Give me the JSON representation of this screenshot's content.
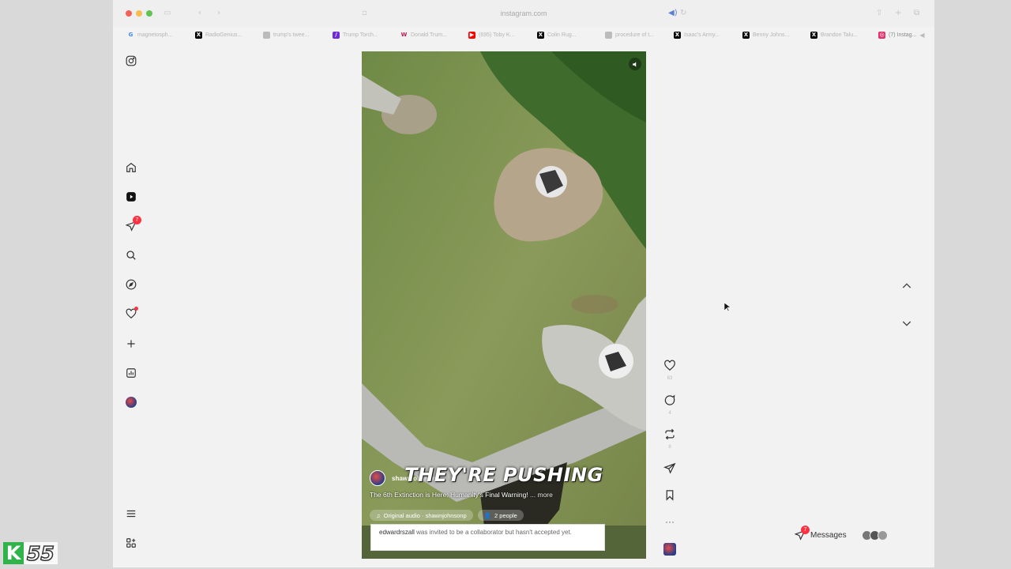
{
  "browser": {
    "url": "instagram.com",
    "tabs": [
      {
        "label": "magnetosph...",
        "icon": "google-icon",
        "color": "#4285f4"
      },
      {
        "label": "RadioGenius...",
        "icon": "x-icon",
        "color": "#000000"
      },
      {
        "label": "trump's twee...",
        "icon": "page-icon",
        "color": "#9a9a9a"
      },
      {
        "label": "Trump Torch...",
        "icon": "substack-icon",
        "color": "#6e2bd9"
      },
      {
        "label": "Donald Trum...",
        "icon": "wikipedia-icon",
        "color": "#c2185b"
      },
      {
        "label": "(695) Toby K...",
        "icon": "youtube-icon",
        "color": "#ff0000"
      },
      {
        "label": "Colin Rug...",
        "icon": "x-icon",
        "color": "#000000"
      },
      {
        "label": "procedure of t...",
        "icon": "page-icon",
        "color": "#9a9a9a"
      },
      {
        "label": "Isaac's Army...",
        "icon": "x-icon",
        "color": "#000000"
      },
      {
        "label": "Benny Johns...",
        "icon": "x-icon",
        "color": "#000000"
      },
      {
        "label": "Brandon Talu...",
        "icon": "x-icon",
        "color": "#000000"
      },
      {
        "label": "(7) Instag...",
        "icon": "instagram-icon",
        "color": "#e1306c"
      }
    ]
  },
  "nav": {
    "notifications_badge": "7"
  },
  "reel": {
    "overlay_text": "THEY'RE PUSHING",
    "author": "shawnjohnsonp",
    "caption": "The 6th Extinction is Here: Humanity's Final Warning!",
    "more_label": "... more",
    "audio_label": "Original audio · shawnjohnsonp",
    "people_label": "2 people",
    "collab_user": "edwardrszall",
    "collab_text": "was invited to be a collaborator but hasn't accepted yet."
  },
  "actions": {
    "likes": "63",
    "comments": "4",
    "reposts": "8"
  },
  "messages": {
    "label": "Messages",
    "badge": "7"
  },
  "channel_bug": {
    "letter": "K",
    "number": "55"
  },
  "colors": {
    "accent_red": "#ff3040",
    "channel_green": "#2fb34a"
  }
}
